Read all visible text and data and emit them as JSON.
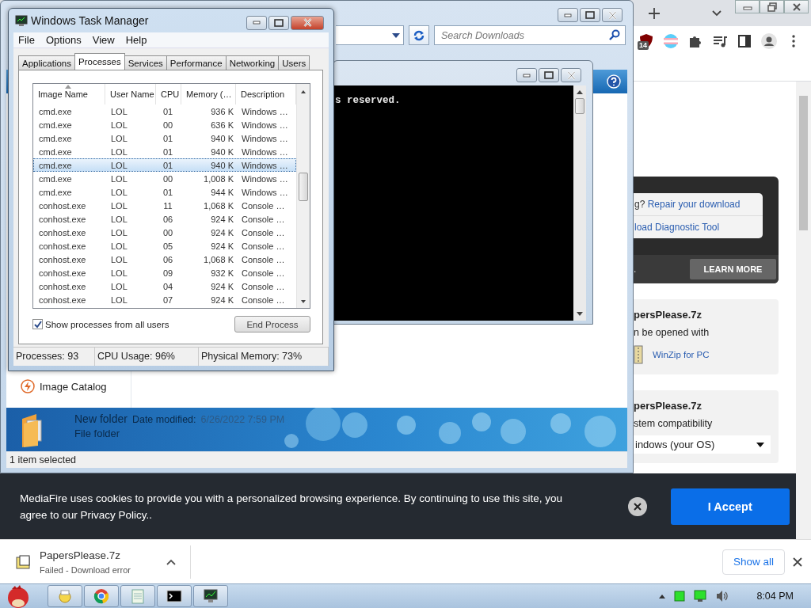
{
  "browser": {
    "extension_badge": "14",
    "promo": {
      "repair_prefix": "g?",
      "repair_link": "Repair your download",
      "diagnostic_link": "load Diagnostic Tool",
      "footer_text": ".",
      "learn_more": "LEARN MORE"
    },
    "cards": [
      {
        "title": "persPlease.7z",
        "subtitle": "n be opened with",
        "app_link": "WinZip for PC"
      },
      {
        "title": "persPlease.7z",
        "subtitle": "stem compatibility",
        "dropdown": "indows (your OS)"
      }
    ]
  },
  "explorer": {
    "search": {
      "placeholder": "Search Downloads"
    },
    "nav_items": [
      {
        "label": "Image Catalog"
      }
    ],
    "details": {
      "name": "New folder",
      "date_label": "Date modified:",
      "date_value": "6/26/2022 7:59 PM",
      "type": "File folder"
    },
    "status": "1 item selected"
  },
  "console": {
    "lines": [
      "s reserved."
    ]
  },
  "task_manager": {
    "title": "Windows Task Manager",
    "menu": [
      "File",
      "Options",
      "View",
      "Help"
    ],
    "tabs": [
      {
        "label": "Applications",
        "selected": false
      },
      {
        "label": "Processes",
        "selected": true
      },
      {
        "label": "Services",
        "selected": false
      },
      {
        "label": "Performance",
        "selected": false
      },
      {
        "label": "Networking",
        "selected": false
      },
      {
        "label": "Users",
        "selected": false
      }
    ],
    "columns": [
      "Image Name",
      "User Name",
      "CPU",
      "Memory (…",
      "Description"
    ],
    "rows": [
      {
        "cells": [
          "cmd.exe",
          "LOL",
          "01",
          "936 K",
          "Windows …"
        ],
        "selected": false
      },
      {
        "cells": [
          "cmd.exe",
          "LOL",
          "00",
          "636 K",
          "Windows …"
        ],
        "selected": false
      },
      {
        "cells": [
          "cmd.exe",
          "LOL",
          "01",
          "940 K",
          "Windows …"
        ],
        "selected": false
      },
      {
        "cells": [
          "cmd.exe",
          "LOL",
          "01",
          "940 K",
          "Windows …"
        ],
        "selected": false
      },
      {
        "cells": [
          "cmd.exe",
          "LOL",
          "01",
          "940 K",
          "Windows …"
        ],
        "selected": true
      },
      {
        "cells": [
          "cmd.exe",
          "LOL",
          "00",
          "1,008 K",
          "Windows …"
        ],
        "selected": false
      },
      {
        "cells": [
          "cmd.exe",
          "LOL",
          "01",
          "944 K",
          "Windows …"
        ],
        "selected": false
      },
      {
        "cells": [
          "conhost.exe",
          "LOL",
          "11",
          "1,068 K",
          "Console …"
        ],
        "selected": false
      },
      {
        "cells": [
          "conhost.exe",
          "LOL",
          "06",
          "924 K",
          "Console …"
        ],
        "selected": false
      },
      {
        "cells": [
          "conhost.exe",
          "LOL",
          "00",
          "924 K",
          "Console …"
        ],
        "selected": false
      },
      {
        "cells": [
          "conhost.exe",
          "LOL",
          "05",
          "924 K",
          "Console …"
        ],
        "selected": false
      },
      {
        "cells": [
          "conhost.exe",
          "LOL",
          "06",
          "1,068 K",
          "Console …"
        ],
        "selected": false
      },
      {
        "cells": [
          "conhost.exe",
          "LOL",
          "09",
          "932 K",
          "Console …"
        ],
        "selected": false
      },
      {
        "cells": [
          "conhost.exe",
          "LOL",
          "04",
          "924 K",
          "Console …"
        ],
        "selected": false
      },
      {
        "cells": [
          "conhost.exe",
          "LOL",
          "07",
          "924 K",
          "Console …"
        ],
        "selected": false
      }
    ],
    "show_all_users": {
      "label": "Show processes from all users",
      "checked": true
    },
    "end_process": "End Process",
    "status": [
      "Processes: 93",
      "CPU Usage: 96%",
      "Physical Memory: 73%"
    ]
  },
  "cookie_banner": {
    "text": "MediaFire uses cookies to provide you with a personalized browsing experience. By continuing to use this site, you agree to our Privacy Policy..",
    "accept": "I Accept"
  },
  "download_shelf": {
    "items": [
      {
        "name": "PapersPlease.7z",
        "status": "Failed - Download error"
      }
    ],
    "show_all": "Show all"
  },
  "taskbar": {
    "clock": "8:04 PM"
  }
}
